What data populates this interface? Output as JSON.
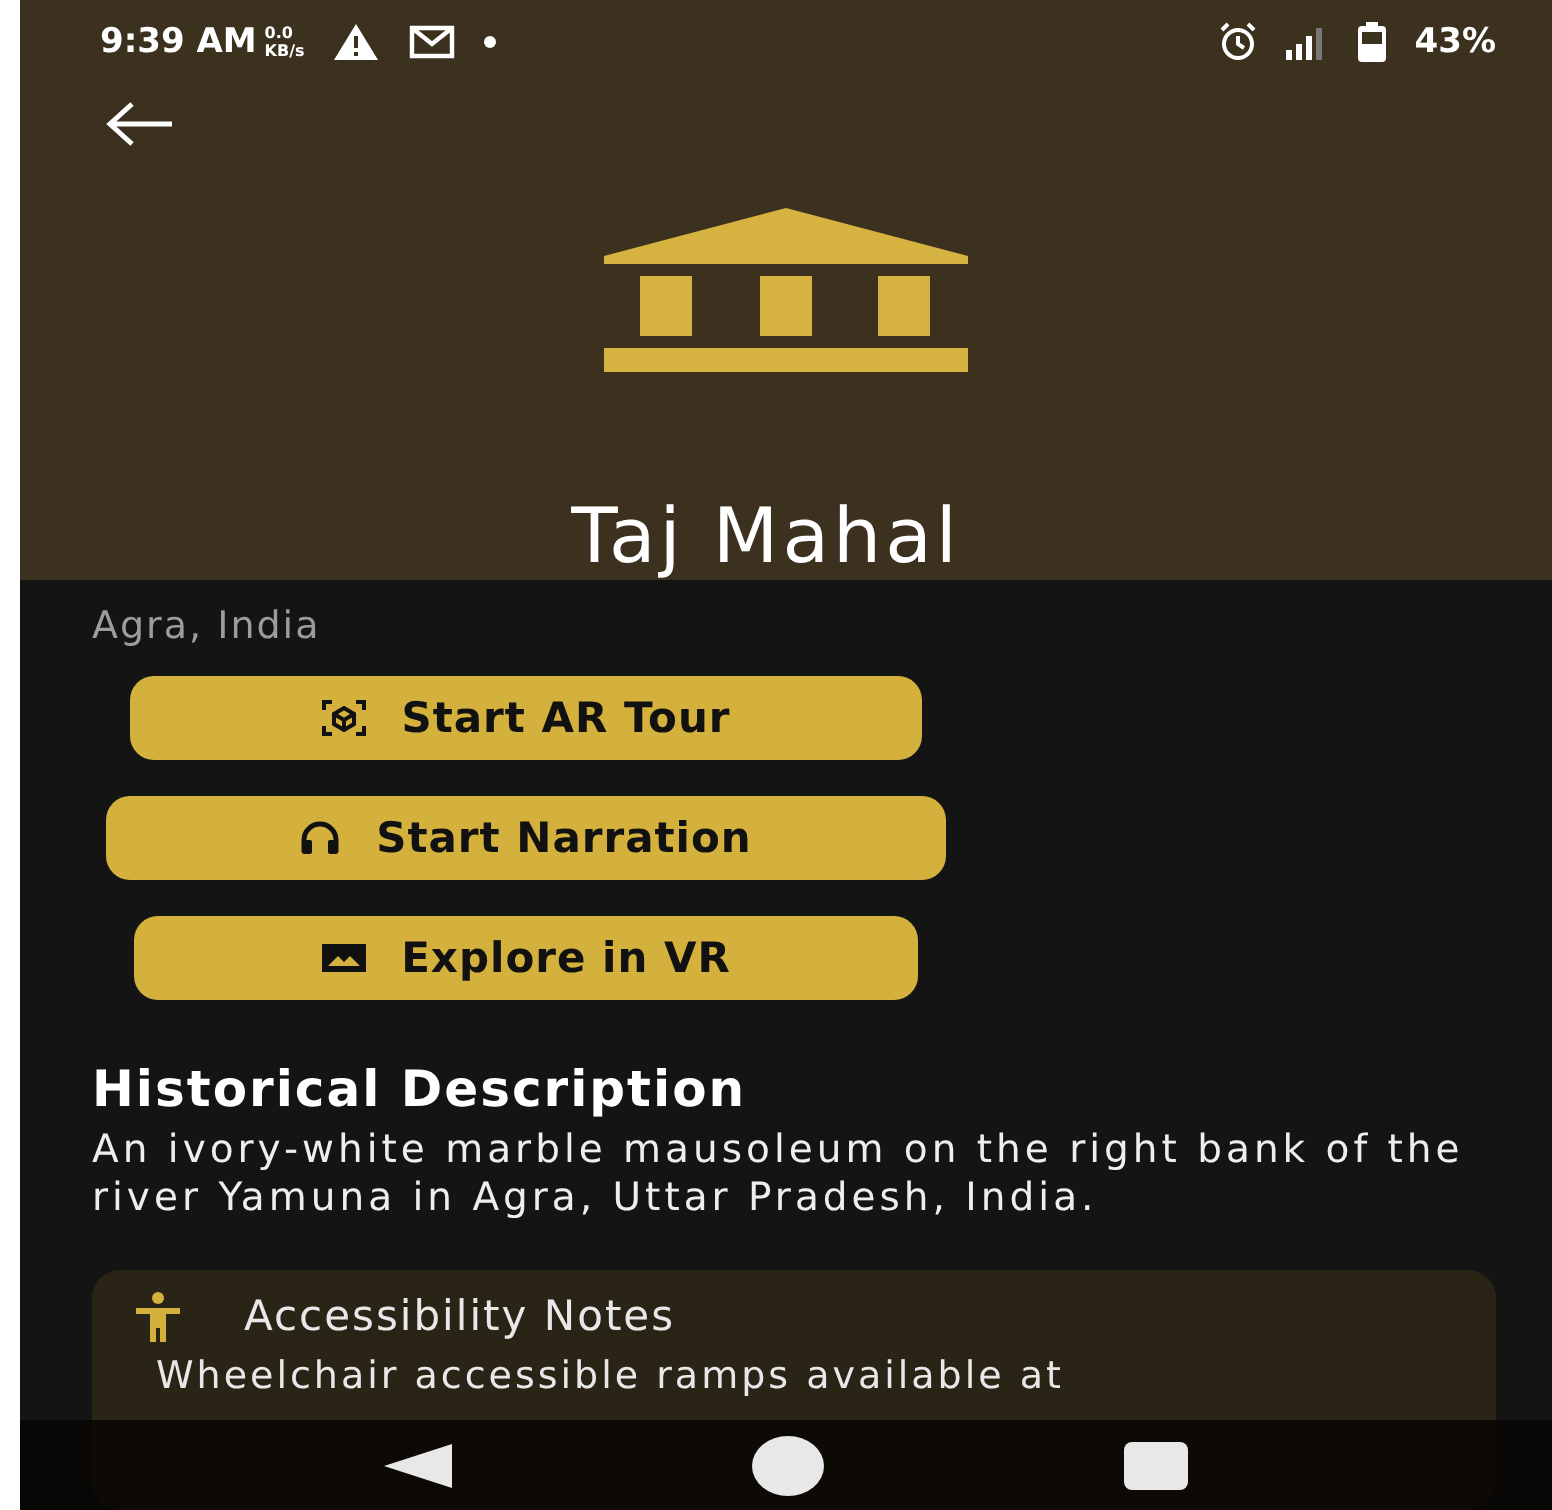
{
  "status_bar": {
    "time": "9:39 AM",
    "speed_value": "0.0",
    "speed_unit": "KB/s",
    "battery": "43%"
  },
  "header": {
    "title": "Taj Mahal"
  },
  "location": "Agra, India",
  "actions": [
    {
      "kind": "ar",
      "label": "Start AR Tour"
    },
    {
      "kind": "audio",
      "label": "Start Narration"
    },
    {
      "kind": "vr",
      "label": "Explore in VR"
    }
  ],
  "description": {
    "heading": "Historical Description",
    "text": "An ivory-white marble mausoleum on the right bank of the river Yamuna in Agra, Uttar Pradesh, India."
  },
  "accessibility": {
    "title": "Accessibility Notes",
    "text": "Wheelchair accessible ramps available at"
  }
}
